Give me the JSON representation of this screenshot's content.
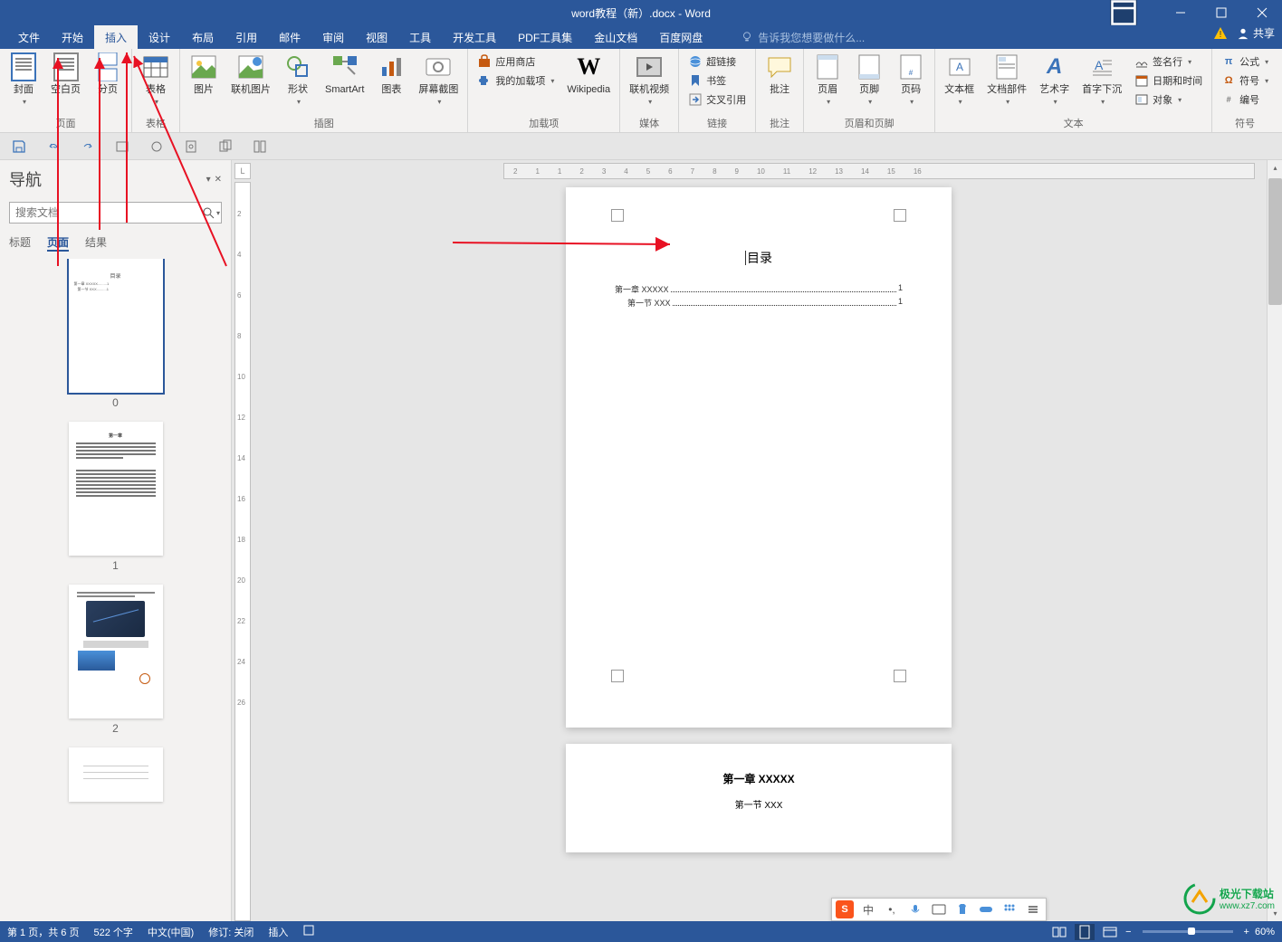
{
  "title": "word教程（新）.docx - Word",
  "share_label": "共享",
  "menu": [
    "文件",
    "开始",
    "插入",
    "设计",
    "布局",
    "引用",
    "邮件",
    "审阅",
    "视图",
    "工具",
    "开发工具",
    "PDF工具集",
    "金山文档",
    "百度网盘"
  ],
  "menu_active_index": 2,
  "tellme_placeholder": "告诉我您想要做什么...",
  "ribbon": {
    "pages": {
      "label": "页面",
      "cover": "封面",
      "blank": "空白页",
      "break": "分页"
    },
    "table": {
      "label": "表格",
      "btn": "表格"
    },
    "illus": {
      "label": "插图",
      "pic": "图片",
      "online_pic": "联机图片",
      "shapes": "形状",
      "smartart": "SmartArt",
      "chart": "图表",
      "screenshot": "屏幕截图"
    },
    "addins": {
      "label": "加载项",
      "store": "应用商店",
      "myaddins": "我的加载项",
      "wiki": "Wikipedia"
    },
    "media": {
      "label": "媒体",
      "video": "联机视频"
    },
    "links": {
      "label": "链接",
      "hyper": "超链接",
      "bookmark": "书签",
      "xref": "交叉引用"
    },
    "comments": {
      "label": "批注",
      "btn": "批注"
    },
    "hf": {
      "label": "页眉和页脚",
      "header": "页眉",
      "footer": "页脚",
      "pageno": "页码"
    },
    "text": {
      "label": "文本",
      "textbox": "文本框",
      "parts": "文档部件",
      "wordart": "艺术字",
      "dropcap": "首字下沉",
      "sigline": "签名行",
      "datetime": "日期和时间",
      "object": "对象"
    },
    "symbols": {
      "label": "符号",
      "equation": "公式",
      "symbol": "符号",
      "number": "编号"
    }
  },
  "nav": {
    "title": "导航",
    "search_placeholder": "搜索文档",
    "tabs": [
      "标题",
      "页面",
      "结果"
    ],
    "active_tab_index": 1,
    "thumbs": [
      "0",
      "1",
      "2"
    ]
  },
  "document": {
    "toc_title": "目录",
    "toc_lines": [
      {
        "text": "第一章 XXXXX",
        "page": "1"
      },
      {
        "text": "第一节 XXX",
        "page": "1"
      }
    ],
    "page2": {
      "h": "第一章 XXXXX",
      "sub": "第一节 XXX"
    }
  },
  "status": {
    "page": "第 1 页，共 6 页",
    "words": "522 个字",
    "lang": "中文(中国)",
    "track": "修订: 关闭",
    "mode": "插入",
    "zoom": "60%"
  },
  "ime": {
    "logo": "S",
    "mode": "中"
  },
  "vruler": [
    "2",
    "4",
    "6",
    "8",
    "10",
    "12",
    "14",
    "16",
    "18",
    "20",
    "22",
    "24",
    "26"
  ],
  "hruler": [
    "2",
    "1",
    "1",
    "2",
    "3",
    "4",
    "5",
    "6",
    "7",
    "8",
    "9",
    "10",
    "11",
    "12",
    "13",
    "14",
    "15",
    "16"
  ],
  "watermark": "极光下载站",
  "watermark_url": "www.xz7.com"
}
